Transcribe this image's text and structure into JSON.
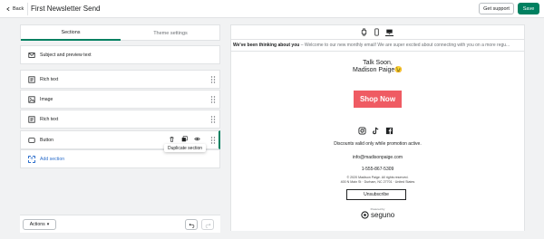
{
  "topbar": {
    "back_label": "Back",
    "title": "First Newsletter Send",
    "support_label": "Get support",
    "save_label": "Save"
  },
  "tabs": [
    {
      "label": "Sections"
    },
    {
      "label": "Theme settings"
    }
  ],
  "sections": [
    {
      "label": "Subject and preview text",
      "icon": "envelope-icon"
    },
    {
      "label": "Rich text",
      "icon": "text-icon"
    },
    {
      "label": "Image",
      "icon": "image-icon"
    },
    {
      "label": "Rich text",
      "icon": "text-icon"
    },
    {
      "label": "Button",
      "icon": "button-icon"
    }
  ],
  "tooltip": "Duplicate section",
  "add_section_label": "Add section",
  "footer": {
    "actions_label": "Actions"
  },
  "preview": {
    "subject": "We've been thinking about you",
    "preheader": " – Welcome to our new monthly email! We are super excited about connecting with you on a more regu...",
    "signoff_line1": "Talk Soon,",
    "signoff_line2": "Madison Paige😉",
    "shop_button": "Shop Now",
    "discount_text": "Discounts valid only while promotion active.",
    "email": "info@madisonpaige.com",
    "phone": "1-555-867-5309",
    "copyright": "© 2020 Madison Paige. All rights reserved.",
    "address": "400 N Main St · Durham, NC 27701 · United States",
    "unsubscribe": "Unsubscribe",
    "powered_by": "Powered by",
    "brand": "seguno"
  },
  "colors": {
    "accent": "#008060",
    "shop_button": "#ef5b63",
    "link": "#2c6ecb"
  }
}
